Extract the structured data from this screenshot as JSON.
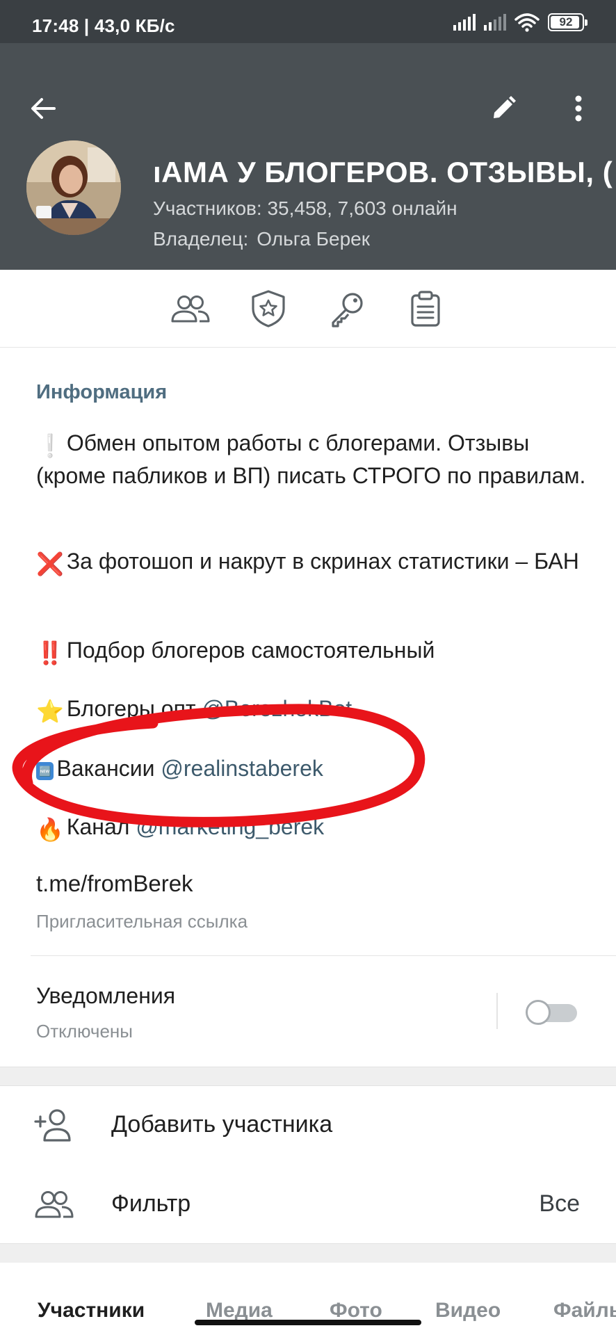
{
  "status_bar": {
    "time": "17:48 | 43,0 КБ/с",
    "battery": "92",
    "icons": [
      "signal-icon",
      "signal-icon",
      "wifi-icon",
      "battery-icon"
    ]
  },
  "header": {
    "back_icon": "arrow-back-icon",
    "edit_icon": "pencil-icon",
    "more_icon": "more-vertical-icon",
    "title": "ıАМА У БЛОГЕРОВ. ОТЗЫВЫ, (",
    "subtitle": "Участников: 35,458, 7,603 онлайн",
    "owner_label": "Владелец:",
    "owner_name": "Ольга Берек"
  },
  "actions": [
    "members-icon",
    "shield-star-icon",
    "key-icon",
    "clipboard-icon"
  ],
  "info": {
    "section_title": "Информация",
    "p1_emoji": "❕",
    "p1": "Обмен опытом работы с блогерами. Отзывы (кроме пабликов и ВП) писать СТРОГО по правилам.",
    "p2_emoji": "❌",
    "p2": "За фотошоп и накрут в скринах статистики – БАН",
    "p3_emoji": "‼️",
    "p3": "Подбор блогеров самостоятельный",
    "p4_emoji": "⭐",
    "p4_text": "Блогеры опт ",
    "p4_link": "@BerezhokBot",
    "p5_emoji": "🆕",
    "p5_text": "Вакансии ",
    "p5_link": "@realinstaberek",
    "p6_emoji": "🔥",
    "p6_text": "Канал ",
    "p6_link": "@marketing_berek",
    "invite_link": "t.me/fromBerek",
    "invite_label": "Пригласительная ссылка"
  },
  "notifications": {
    "title": "Уведомления",
    "status": "Отключены",
    "enabled": false
  },
  "menu": {
    "add_member": "Добавить участника",
    "filter": "Фильтр",
    "filter_value": "Все"
  },
  "tabs": [
    "Участники",
    "Медиа",
    "Фото",
    "Видео",
    "Файлы"
  ],
  "colors": {
    "header_bg": "#4a5054",
    "status_bg": "#3a3f43",
    "accent": "#4f6d80",
    "annotation": "#e8141a"
  }
}
